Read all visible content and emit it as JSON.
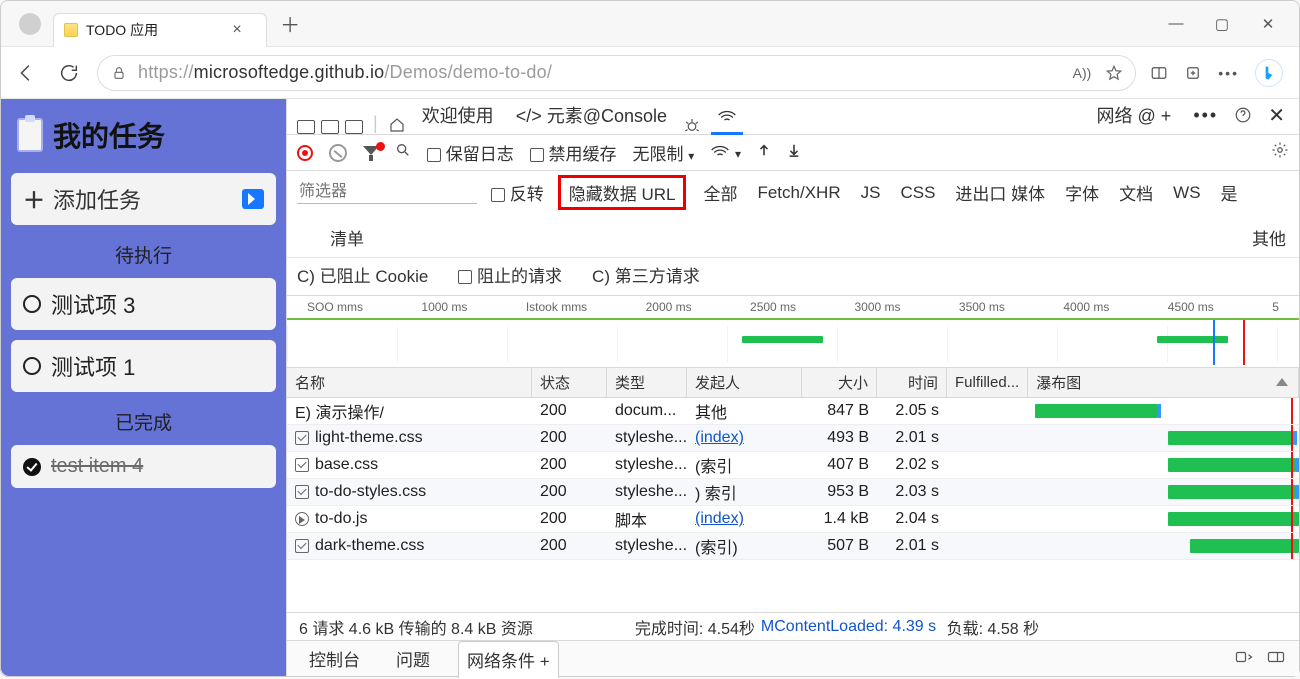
{
  "tab": {
    "title": "TODO 应用"
  },
  "url": {
    "host": "microsoftedge.github.io",
    "path": "/Demos/demo-to-do/"
  },
  "actions": {
    "readAloud": "A))"
  },
  "app": {
    "title": "我的任务",
    "add": "添加任务",
    "pending_header": "待执行",
    "done_header": "已完成",
    "pending": [
      "测试项 3",
      "测试项 1"
    ],
    "done": [
      "test item 4"
    ]
  },
  "devtools": {
    "tabs": {
      "welcome": "欢迎使用",
      "elements": "元素@Console",
      "network": "网络 @ +"
    },
    "toolbar": {
      "preserve": "保留日志",
      "disableCache": "禁用缓存",
      "throttle": "无限制"
    },
    "filter": {
      "placeholder": "筛选器",
      "invert": "反转",
      "hideData": "隐藏数据 URL",
      "all": "全部",
      "types": [
        "Fetch/XHR",
        "JS",
        "CSS",
        "进出口 媒体",
        "字体",
        "文档",
        "WS",
        "是"
      ],
      "manifest": "清单",
      "other": "其他",
      "blockedCookies": "C) 已阻止 Cookie",
      "blockedReq": "阻止的请求",
      "thirdParty": "C) 第三方请求"
    },
    "timeline_ticks": [
      "SOO mms",
      "1000 ms",
      "Istook mms",
      "2000 ms",
      "2500 ms",
      "3000 ms",
      "3500 ms",
      "4000 ms",
      "4500 ms",
      "5"
    ],
    "columns": {
      "name": "名称",
      "status": "状态",
      "type": "类型",
      "initiator": "发起人",
      "size": "大小",
      "time": "时间",
      "fulfilled": "Fulfilled...",
      "waterfall": "瀑布图"
    },
    "rows": [
      {
        "name": "E) 演示操作/",
        "status": "200",
        "type": "docum...",
        "init": "其他",
        "initLink": false,
        "size": "847 B",
        "time": "2.05 s",
        "wfStart": 3,
        "wfLen": 45
      },
      {
        "name": "light-theme.css",
        "status": "200",
        "type": "styleshe...",
        "init": "(index)",
        "initLink": true,
        "size": "493 B",
        "time": "2.01 s",
        "wfStart": 52,
        "wfLen": 46
      },
      {
        "name": "base.css",
        "status": "200",
        "type": "styleshe...",
        "init": "(索引",
        "initLink": false,
        "size": "407 B",
        "time": "2.02 s",
        "wfStart": 52,
        "wfLen": 47
      },
      {
        "name": "to-do-styles.css",
        "status": "200",
        "type": "styleshe...",
        "init": ") 索引",
        "initLink": false,
        "size": "953 B",
        "time": "2.03 s",
        "wfStart": 52,
        "wfLen": 47
      },
      {
        "name": "to-do.js",
        "status": "200",
        "type": "脚本",
        "init": "(index)",
        "initLink": true,
        "size": "1.4 kB",
        "time": "2.04 s",
        "wfStart": 52,
        "wfLen": 48
      },
      {
        "name": "dark-theme.css",
        "status": "200",
        "type": "styleshe...",
        "init": "(索引)",
        "initLink": false,
        "size": "507 B",
        "time": "2.01 s",
        "wfStart": 60,
        "wfLen": 40
      }
    ],
    "summary": {
      "requests": "6 请求 4.6 kB 传输的 8.4 kB 资源",
      "finish": "完成时间: 4.54秒",
      "dom": "MContentLoaded: 4.39 s",
      "load": "负载: 4.58 秒"
    },
    "drawer": {
      "console": "控制台",
      "issues": "问题",
      "netcond": "网络条件 +"
    }
  }
}
